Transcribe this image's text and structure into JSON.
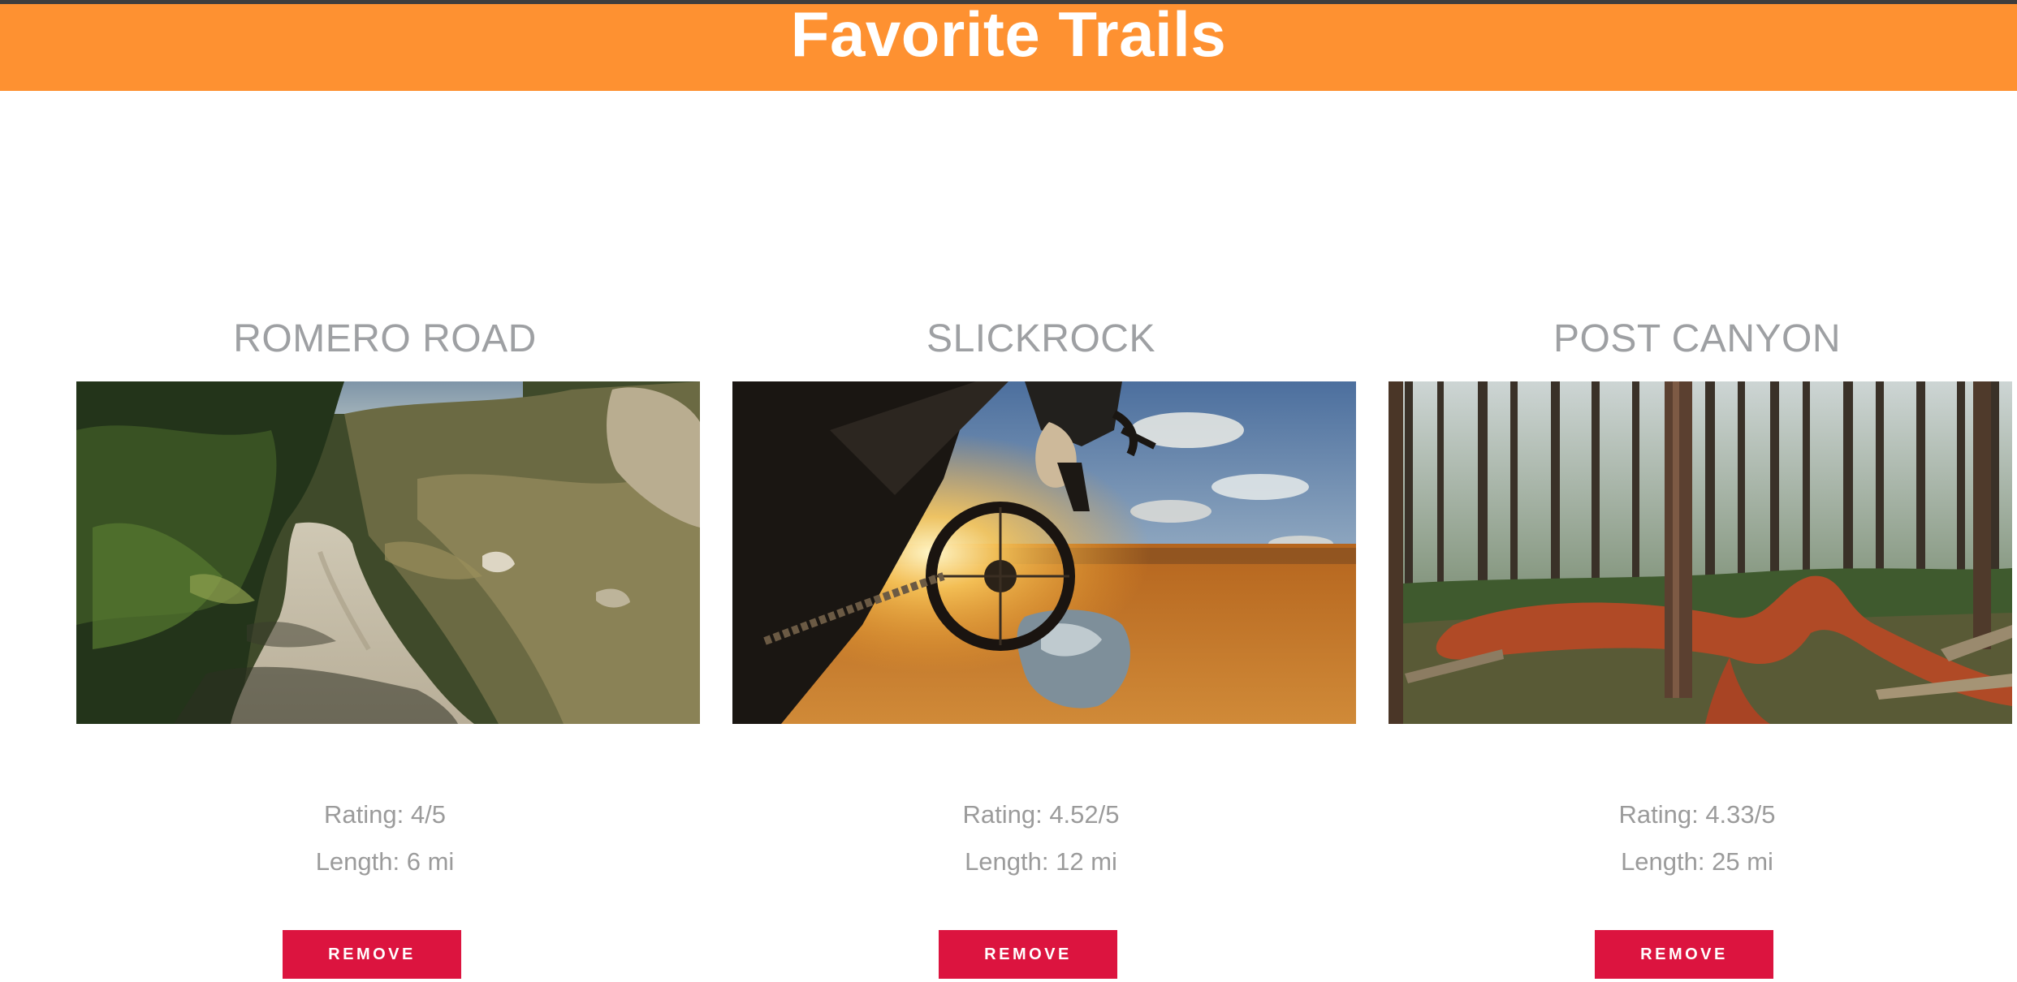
{
  "header": {
    "title": "Favorite Trails"
  },
  "colors": {
    "header_bg": "#fe9131",
    "remove_button_bg": "#dc143f",
    "title_text": "#9ea0a3",
    "stat_text": "#9b9b9b"
  },
  "trails": [
    {
      "name": "ROMERO ROAD",
      "photo": "dirt-trail-photo",
      "rating": "Rating: 4/5",
      "length": "Length: 6 mi",
      "remove_label": "REMOVE"
    },
    {
      "name": "SLICKROCK",
      "photo": "mountain-bike-sunset-photo",
      "rating": "Rating: 4.52/5",
      "length": "Length: 12 mi",
      "remove_label": "REMOVE"
    },
    {
      "name": "POST CANYON",
      "photo": "forest-trail-photo",
      "rating": "Rating: 4.33/5",
      "length": "Length: 25 mi",
      "remove_label": "REMOVE"
    }
  ]
}
